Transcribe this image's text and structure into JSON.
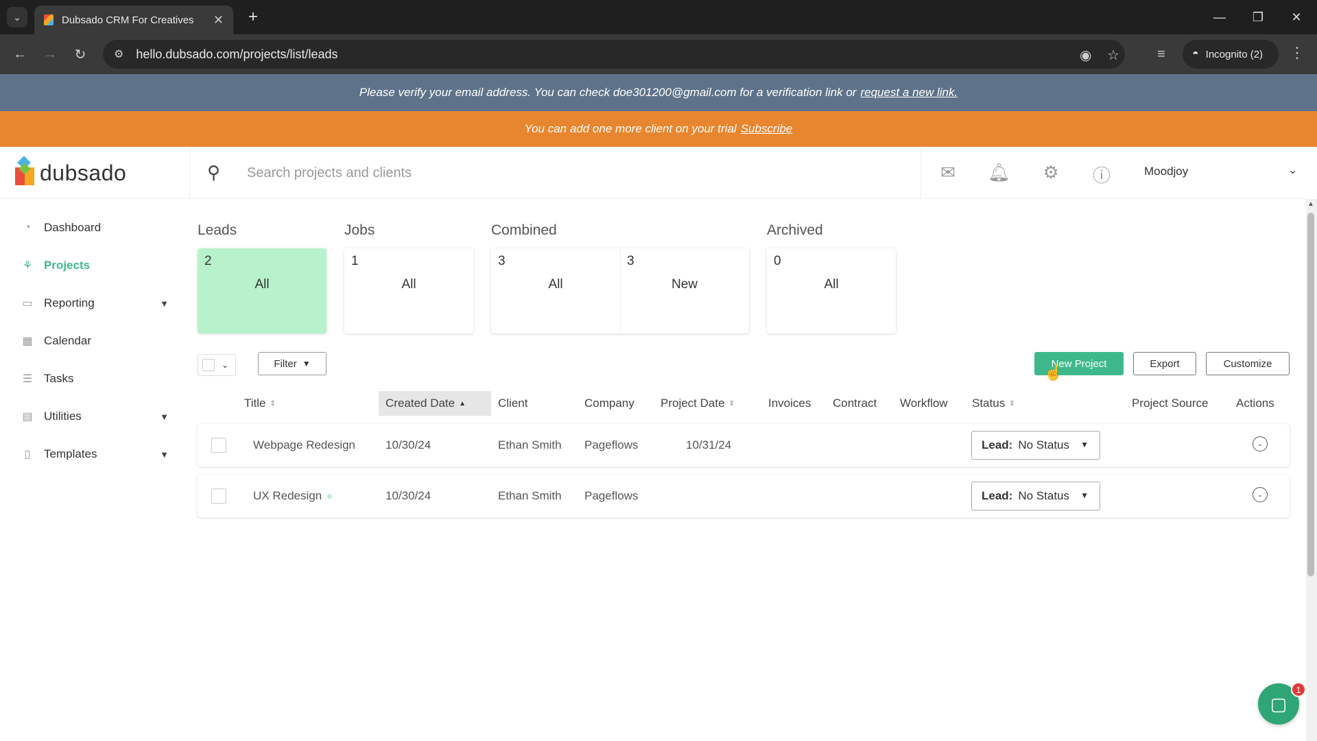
{
  "browser": {
    "tab_title": "Dubsado CRM For Creatives",
    "url": "hello.dubsado.com/projects/list/leads",
    "incognito_label": "Incognito (2)"
  },
  "banners": {
    "verify_text": "Please verify your email address. You can check doe301200@gmail.com for a verification link or",
    "verify_link": "request a new link.",
    "trial_text": "You can add one more client on your trial",
    "trial_link": "Subscribe"
  },
  "header": {
    "logo_text": "dubsado",
    "search_placeholder": "Search projects and clients",
    "user_name": "Moodjoy"
  },
  "sidebar": {
    "items": [
      {
        "label": "Dashboard"
      },
      {
        "label": "Projects"
      },
      {
        "label": "Reporting"
      },
      {
        "label": "Calendar"
      },
      {
        "label": "Tasks"
      },
      {
        "label": "Utilities"
      },
      {
        "label": "Templates"
      }
    ]
  },
  "summary": {
    "leads": {
      "label": "Leads",
      "count": "2",
      "name": "All"
    },
    "jobs": {
      "label": "Jobs",
      "count": "1",
      "name": "All"
    },
    "combined": {
      "label": "Combined",
      "all_count": "3",
      "all_name": "All",
      "new_count": "3",
      "new_name": "New"
    },
    "archived": {
      "label": "Archived",
      "count": "0",
      "name": "All"
    }
  },
  "toolbar": {
    "filter_label": "Filter",
    "new_project_label": "New Project",
    "export_label": "Export",
    "customize_label": "Customize"
  },
  "table": {
    "headers": {
      "title": "Title",
      "created_date": "Created Date",
      "client": "Client",
      "company": "Company",
      "project_date": "Project Date",
      "invoices": "Invoices",
      "contract": "Contract",
      "workflow": "Workflow",
      "status": "Status",
      "project_source": "Project Source",
      "actions": "Actions"
    },
    "rows": [
      {
        "title": "Webpage Redesign",
        "created": "10/30/24",
        "client": "Ethan Smith",
        "company": "Pageflows",
        "project_date": "10/31/24",
        "status_prefix": "Lead:",
        "status_value": "No Status"
      },
      {
        "title": "UX Redesign",
        "created": "10/30/24",
        "client": "Ethan Smith",
        "company": "Pageflows",
        "project_date": "",
        "status_prefix": "Lead:",
        "status_value": "No Status"
      }
    ]
  },
  "chat": {
    "badge": "1"
  },
  "colors": {
    "accent": "#3fb98b",
    "trial_banner": "#e8862f",
    "verify_banner": "#5e7389",
    "active_card": "#b7f2cc"
  }
}
